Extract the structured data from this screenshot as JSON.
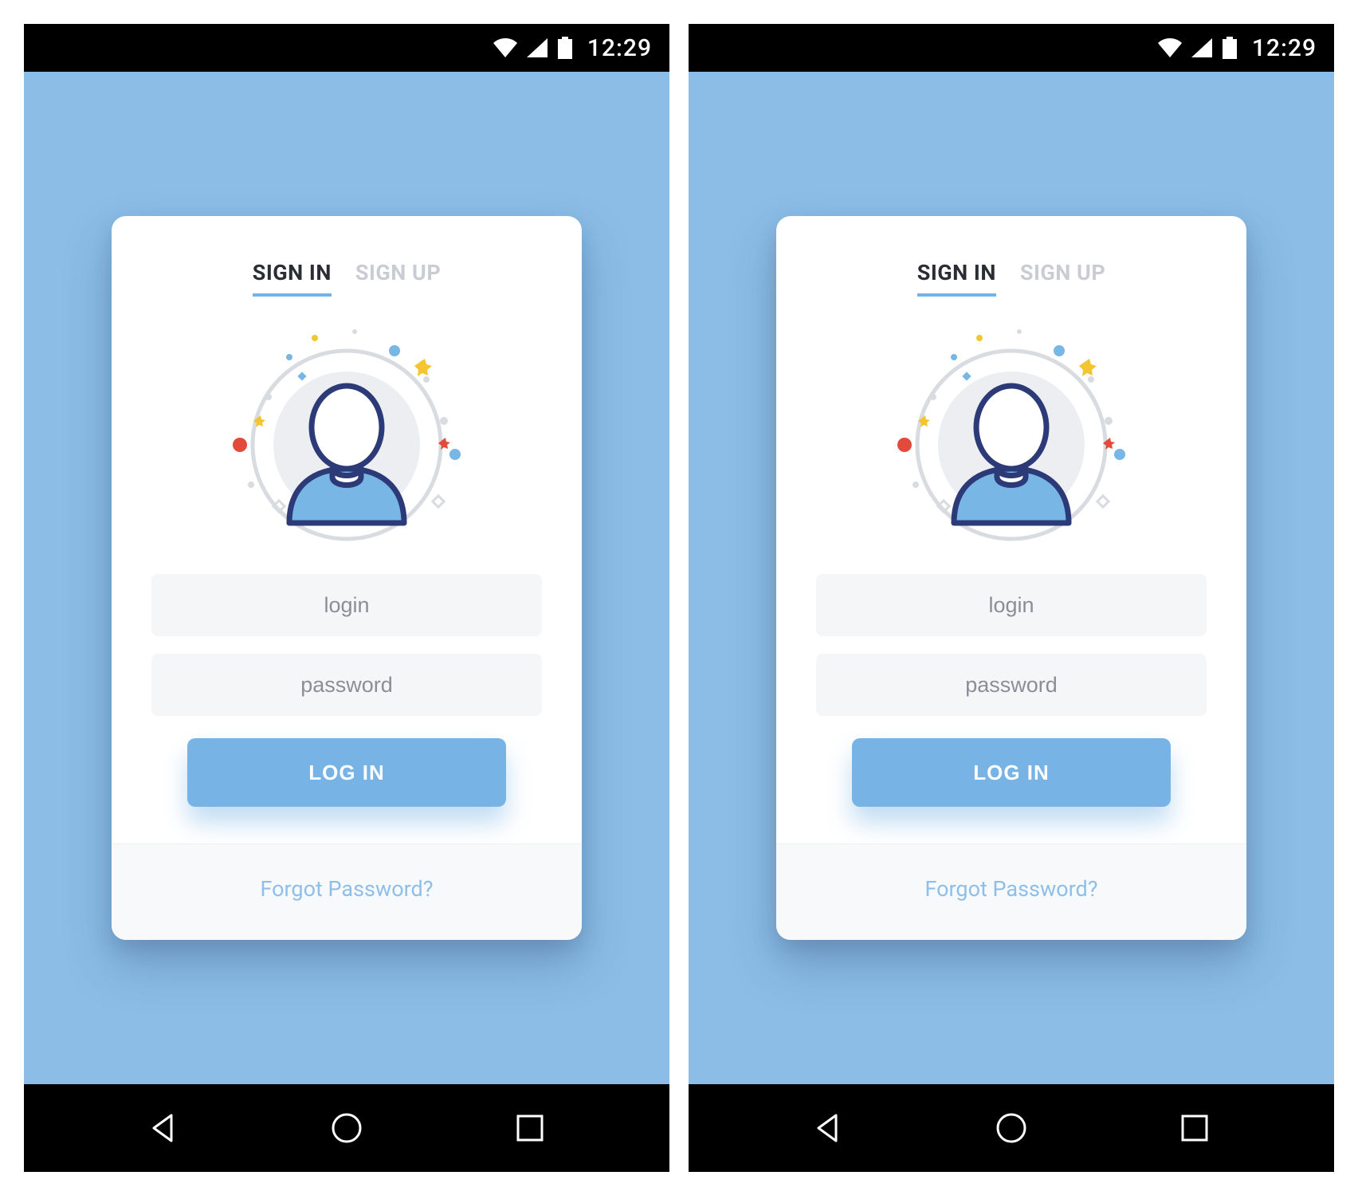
{
  "status": {
    "time": "12:29"
  },
  "tabs": {
    "signin": "SIGN IN",
    "signup": "SIGN UP",
    "active": "signin"
  },
  "fields": {
    "login_placeholder": "login",
    "password_placeholder": "password"
  },
  "buttons": {
    "login": "LOG IN"
  },
  "footer": {
    "forgot": "Forgot Password?"
  },
  "colors": {
    "bg": "#8bbde6",
    "primary": "#77b4e5",
    "text_muted": "#c9ccd2",
    "text": "#2a2d34",
    "field_bg": "#f5f6f8",
    "link": "#8fbfe9"
  }
}
